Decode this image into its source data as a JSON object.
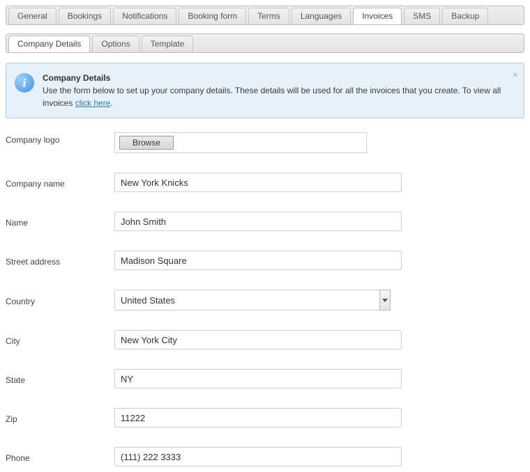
{
  "mainTabs": {
    "items": [
      "General",
      "Bookings",
      "Notifications",
      "Booking form",
      "Terms",
      "Languages",
      "Invoices",
      "SMS",
      "Backup"
    ],
    "activeIndex": 6
  },
  "subTabs": {
    "items": [
      "Company Details",
      "Options",
      "Template"
    ],
    "activeIndex": 0
  },
  "infobox": {
    "title": "Company Details",
    "body_before_link": "Use the form below to set up your company details. These details will be used for all the invoices that you create. To view all invoices ",
    "link_text": "click here",
    "body_after_link": "."
  },
  "form": {
    "logo": {
      "label": "Company logo",
      "button": "Browse"
    },
    "company_name": {
      "label": "Company name",
      "value": "New York Knicks"
    },
    "name": {
      "label": "Name",
      "value": "John Smith"
    },
    "street": {
      "label": "Street address",
      "value": "Madison Square"
    },
    "country": {
      "label": "Country",
      "value": "United States"
    },
    "city": {
      "label": "City",
      "value": "New York City"
    },
    "state": {
      "label": "State",
      "value": "NY"
    },
    "zip": {
      "label": "Zip",
      "value": "11222"
    },
    "phone": {
      "label": "Phone",
      "value": "(111) 222 3333"
    }
  }
}
